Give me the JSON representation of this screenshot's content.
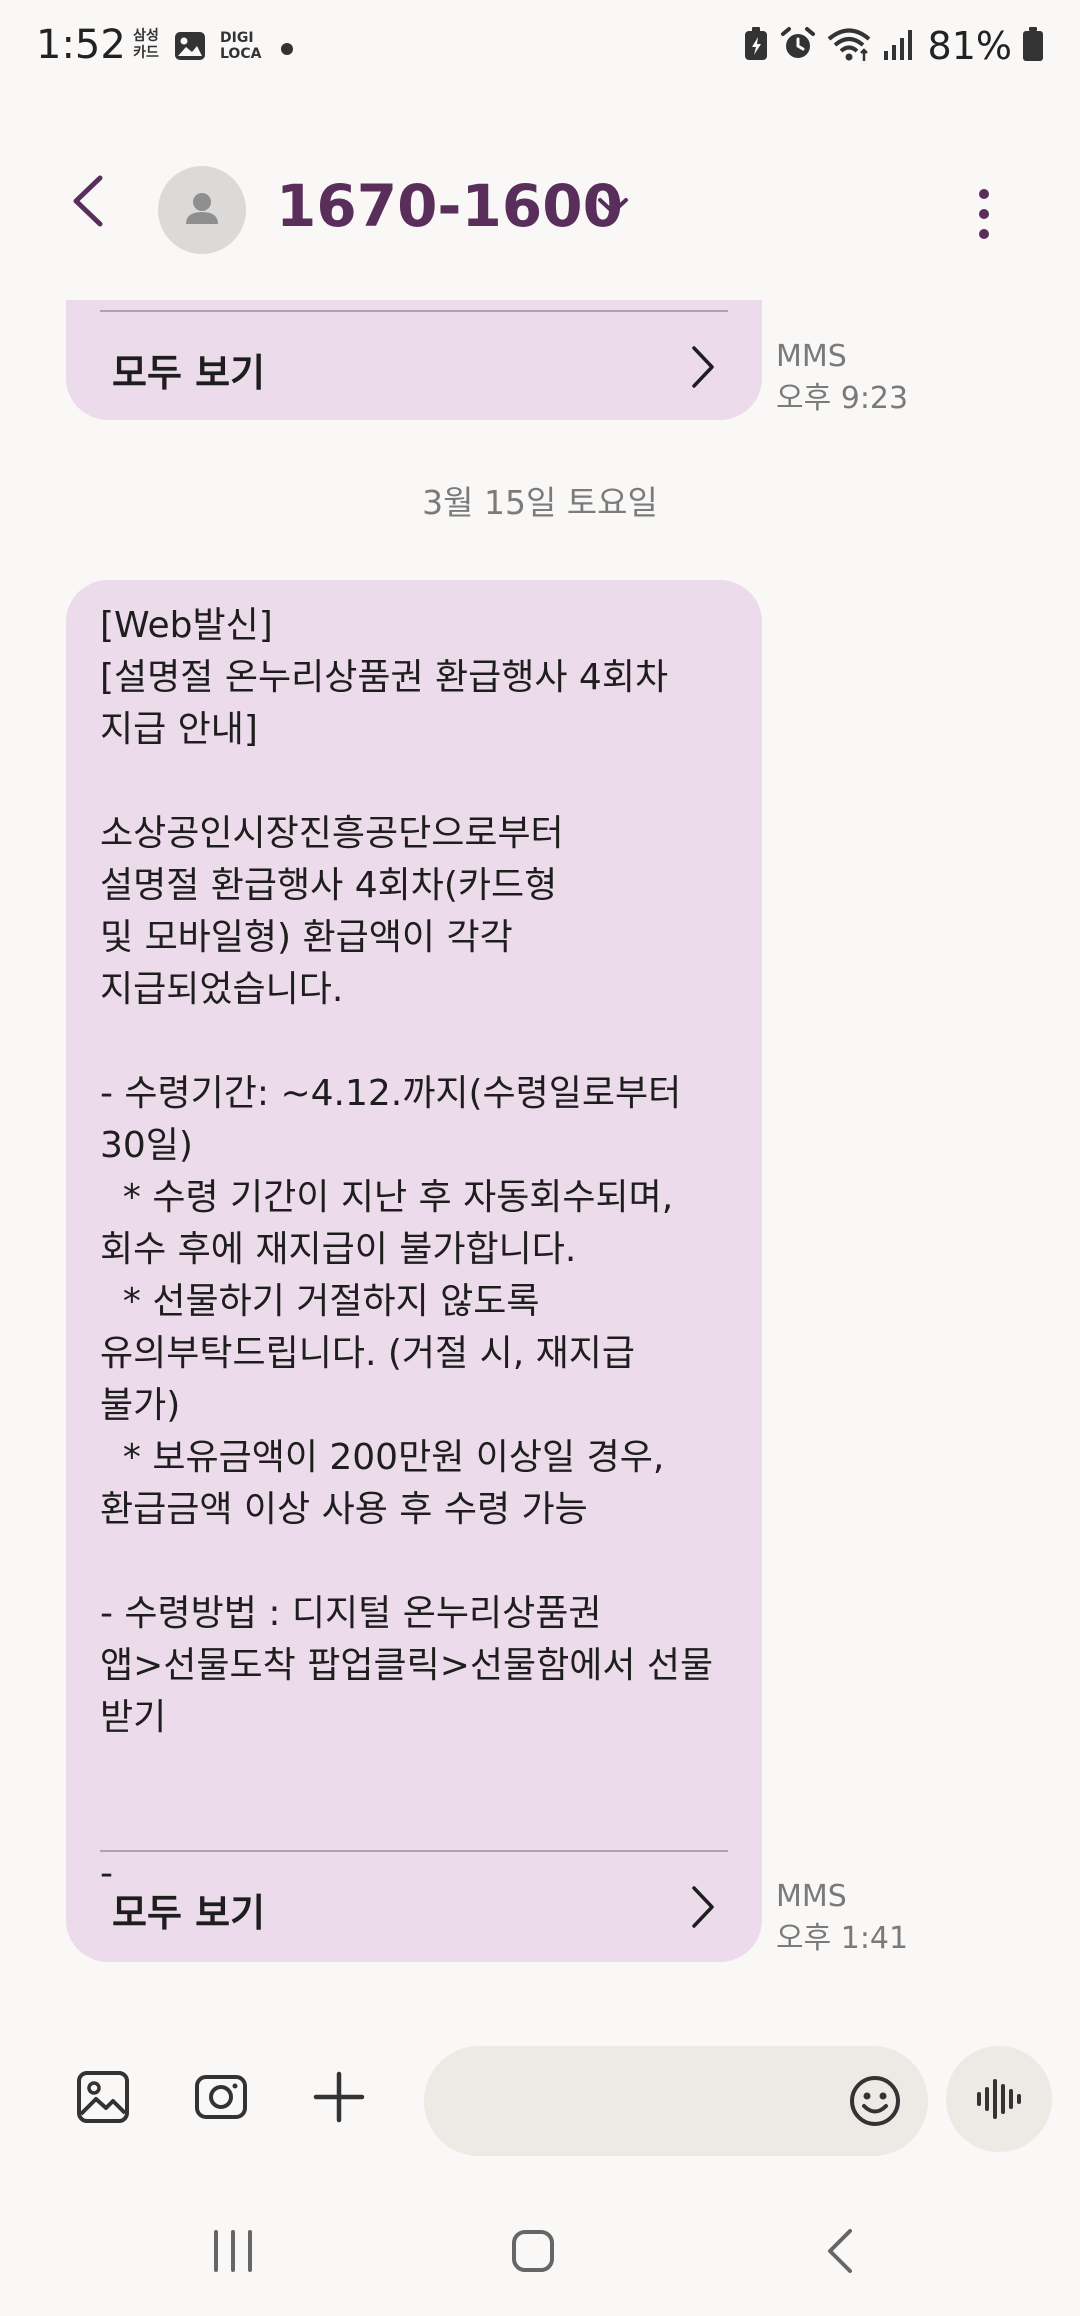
{
  "status_bar": {
    "time": "1:52",
    "samsung_card": "삼성\n카드",
    "digi_loca": "DIGI\nLOCA",
    "battery": "81%"
  },
  "header": {
    "contact": "1670-1600"
  },
  "messages": [
    {
      "see_all": "모두 보기",
      "type": "MMS",
      "time": "오후 9:23"
    },
    {
      "text": "[Web발신]\n[설명절 온누리상품권 환급행사 4회차\n지급 안내]\n\n소상공인시장진흥공단으로부터\n설명절 환급행사 4회차(카드형\n및 모바일형) 환급액이 각각\n지급되었습니다.\n\n- 수령기간: ~4.12.까지(수령일로부터\n30일)\n  * 수령 기간이 지난 후 자동회수되며,\n회수 후에 재지급이 불가합니다.\n  * 선물하기 거절하지 않도록\n유의부탁드립니다. (거절 시, 재지급\n불가)\n  * 보유금액이 200만원 이상일 경우,\n환급금액 이상 사용 후 수령 가능\n\n- 수령방법 : 디지털 온누리상품권\n앱>선물도착 팝업클릭>선물함에서 선물\n받기\n\n\n-",
      "see_all": "모두 보기",
      "type": "MMS",
      "time": "오후 1:41"
    }
  ],
  "date_separator": "3월 15일 토요일",
  "input": {
    "placeholder": ""
  },
  "colors": {
    "bubble": "#ecdbea",
    "title": "#5a2e5a",
    "background": "#f9f8f7"
  }
}
